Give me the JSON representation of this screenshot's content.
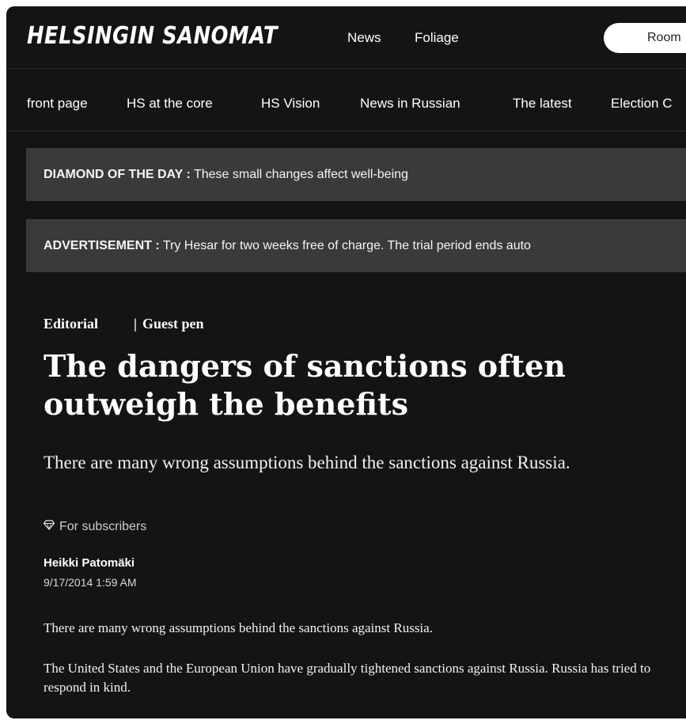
{
  "header": {
    "logo": "HELSINGIN SANOMAT",
    "links": [
      "News",
      "Foliage"
    ],
    "room_button": "Room"
  },
  "nav": {
    "items": [
      "front page",
      "HS at the core",
      "HS Vision",
      "News in Russian",
      "The latest",
      "Election C"
    ]
  },
  "banners": {
    "diamond": {
      "label": "DIAMOND OF THE DAY :",
      "text": "These small changes affect well-being"
    },
    "ad": {
      "label": "ADVERTISEMENT :",
      "text": "Try Hesar for two weeks free of charge. The trial period ends auto"
    }
  },
  "article": {
    "section": "Editorial",
    "separator": "|",
    "subsection": "Guest pen",
    "title": "The dangers of sanctions often outweigh the benefits",
    "lead": "There are many wrong assumptions behind the sanctions against Russia.",
    "subscriber_label": "For subscribers",
    "author": "Heikki Patomäki",
    "date": "9/17/2014 1:59 AM",
    "paragraphs": [
      "There are many wrong assumptions behind the sanctions against Russia.",
      "The United States and the European Union have gradually tightened sanctions against Russia. Russia has tried to respond in kind."
    ]
  },
  "icons": {
    "subscriber": "diamond-icon"
  },
  "colors": {
    "background": "#141414",
    "banner": "#3a3a3a",
    "text": "#ffffff"
  }
}
